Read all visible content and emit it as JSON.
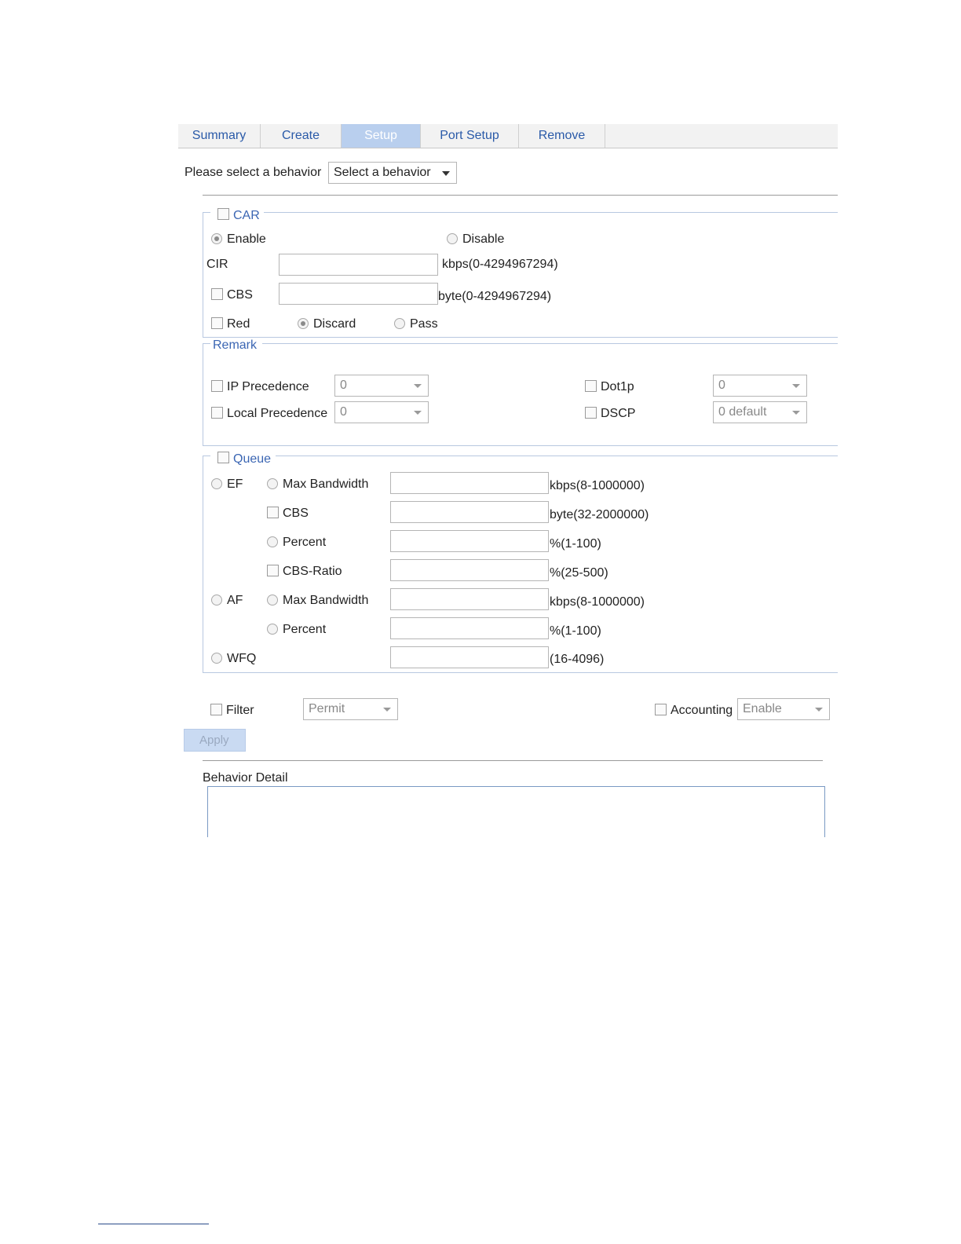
{
  "tabs": [
    "Summary",
    "Create",
    "Setup",
    "Port Setup",
    "Remove"
  ],
  "behavior": {
    "label": "Please select a behavior",
    "selected": "Select a behavior"
  },
  "car": {
    "title": "CAR",
    "enable": "Enable",
    "disable": "Disable",
    "cir_label": "CIR",
    "cir_range": "kbps(0-4294967294)",
    "cbs_label": "CBS",
    "cbs_range": "byte(0-4294967294)",
    "red_label": "Red",
    "discard": "Discard",
    "pass": "Pass"
  },
  "remark": {
    "title": "Remark",
    "ip_precedence": "IP Precedence",
    "ip_precedence_value": "0",
    "local_precedence": "Local Precedence",
    "local_precedence_value": "0",
    "dot1p": "Dot1p",
    "dot1p_value": "0",
    "dscp": "DSCP",
    "dscp_value": "0 default"
  },
  "queue": {
    "title": "Queue",
    "ef": "EF",
    "af": "AF",
    "wfq": "WFQ",
    "max_bandwidth": "Max Bandwidth",
    "cbs": "CBS",
    "percent": "Percent",
    "cbs_ratio": "CBS-Ratio",
    "ef_max_bw_range": "kbps(8-1000000)",
    "ef_cbs_range": "byte(32-2000000)",
    "ef_percent_range": "%(1-100)",
    "ef_cbs_ratio_range": "%(25-500)",
    "af_max_bw_range": "kbps(8-1000000)",
    "af_percent_range": "%(1-100)",
    "wfq_range": "(16-4096)"
  },
  "filter": {
    "label": "Filter",
    "value": "Permit"
  },
  "accounting": {
    "label": "Accounting",
    "value": "Enable"
  },
  "apply_label": "Apply",
  "behavior_detail": "Behavior Detail"
}
